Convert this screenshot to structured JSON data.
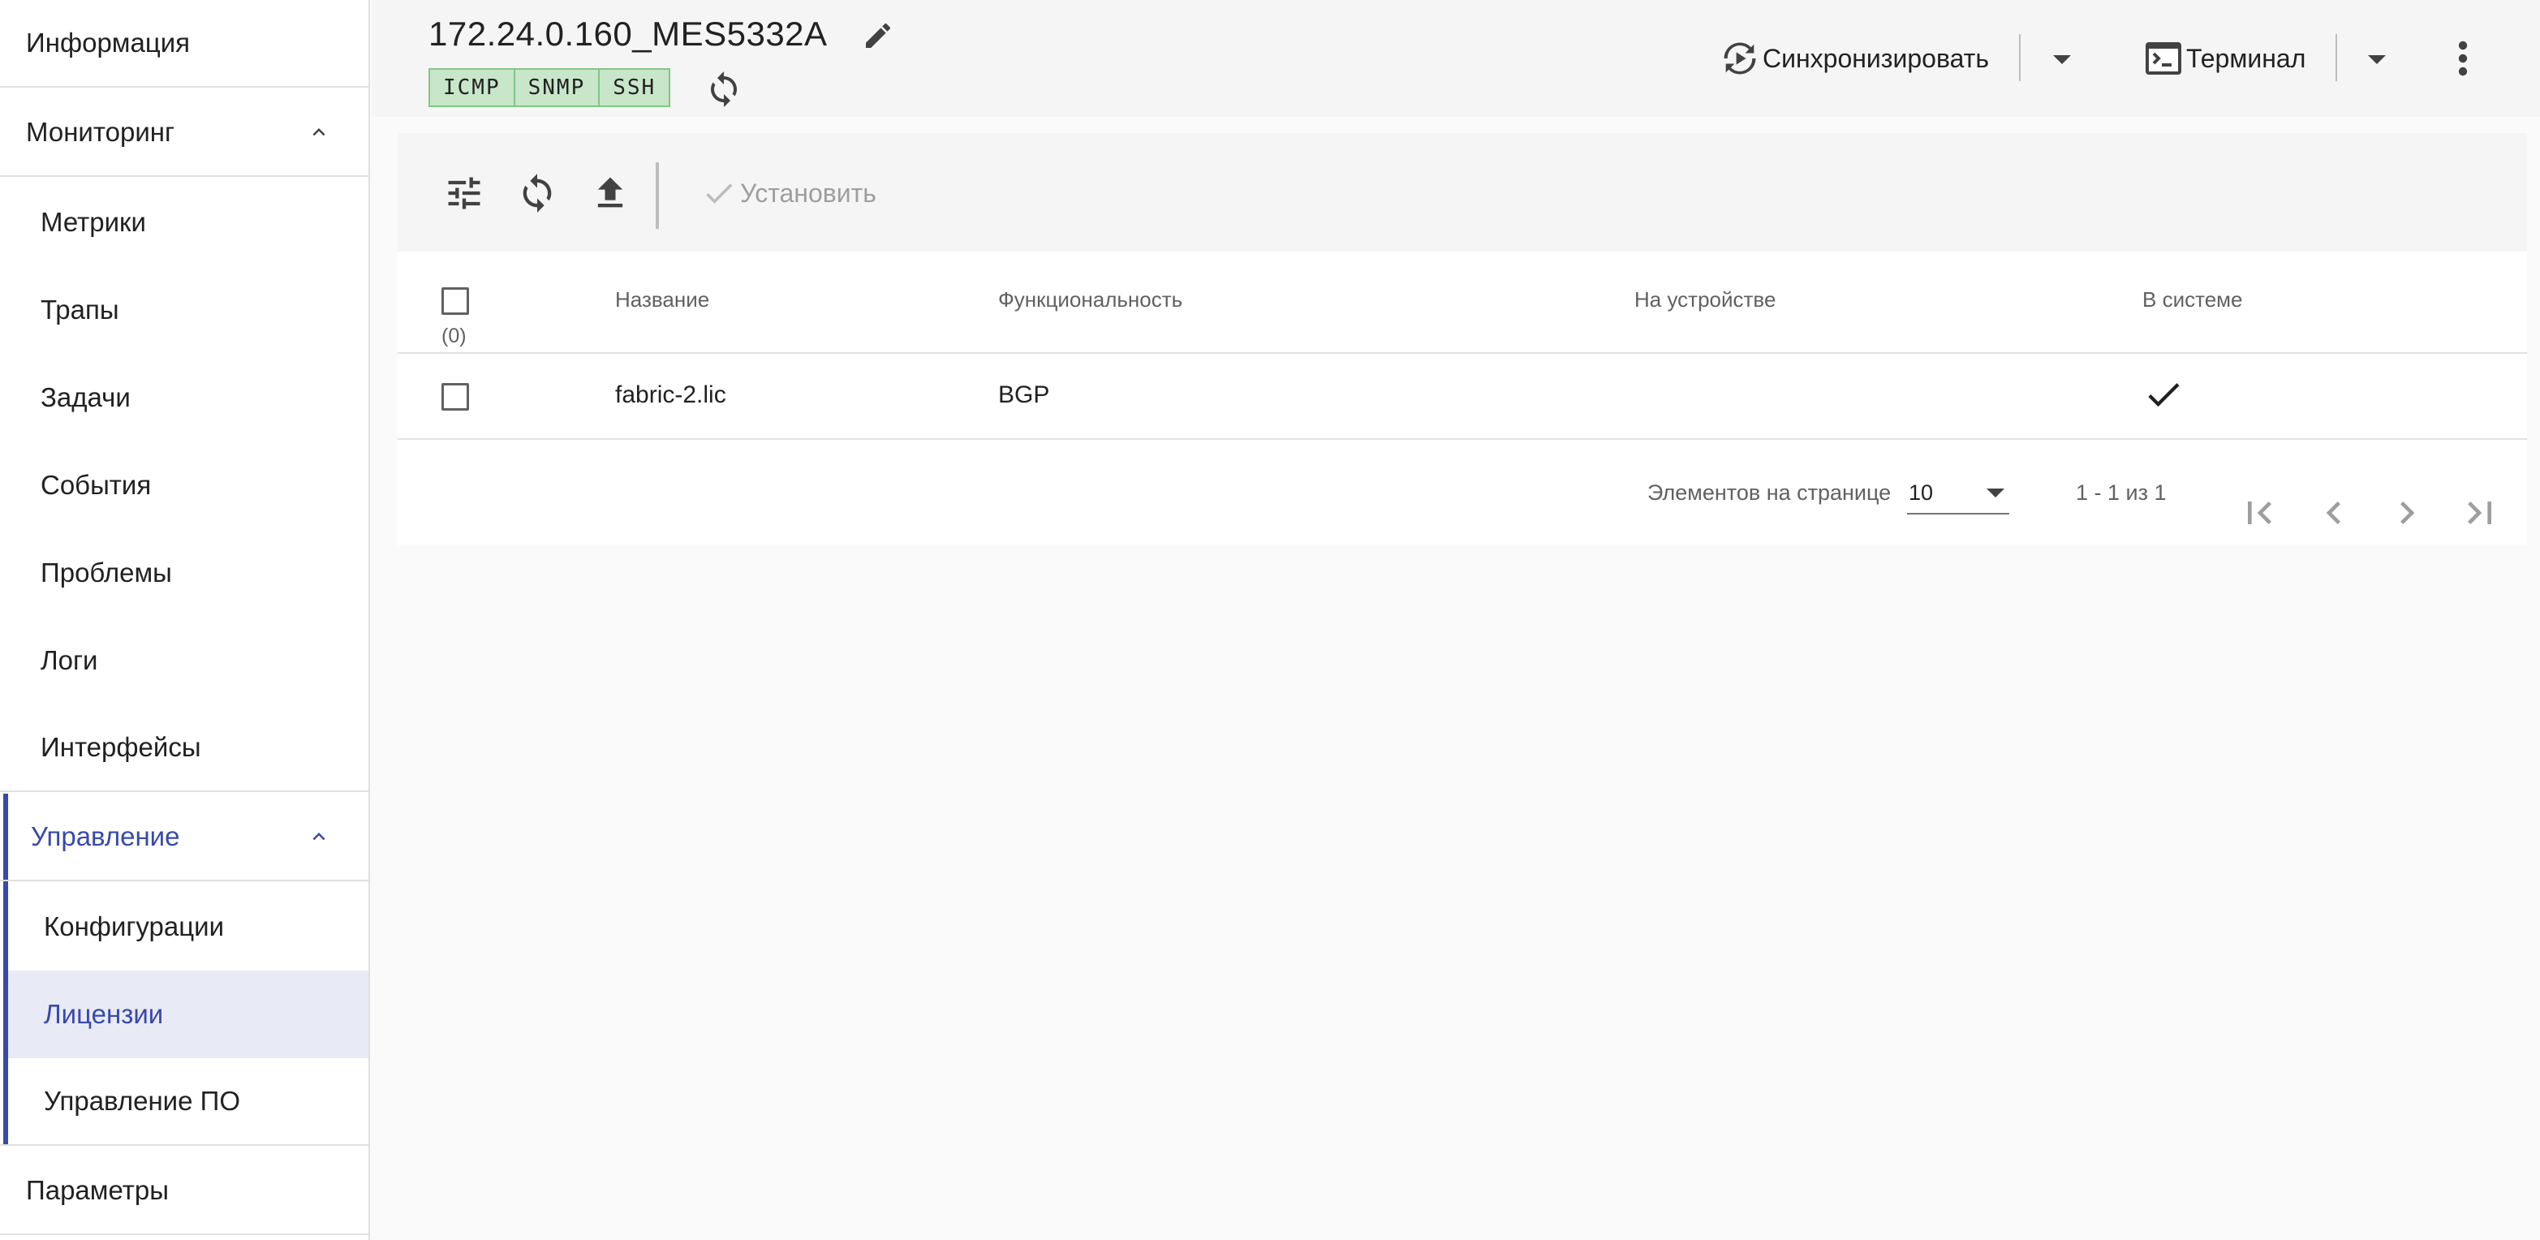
{
  "sidebar": {
    "info": "Информация",
    "monitoring": "Мониторинг",
    "monitoring_items": [
      "Метрики",
      "Трапы",
      "Задачи",
      "События",
      "Проблемы",
      "Логи",
      "Интерфейсы"
    ],
    "management": "Управление",
    "management_items": [
      "Конфигурации",
      "Лицензии",
      "Управление ПО"
    ],
    "active_item": "Лицензии",
    "params": "Параметры"
  },
  "header": {
    "title": "172.24.0.160_MES5332A",
    "badges": [
      "ICMP",
      "SNMP",
      "SSH"
    ],
    "sync_label": "Синхронизировать",
    "terminal_label": "Терминал"
  },
  "toolbar": {
    "install_label": "Установить"
  },
  "table": {
    "selected_count": "(0)",
    "columns": [
      "Название",
      "Функциональность",
      "На устройстве",
      "В системе"
    ],
    "rows": [
      {
        "name": "fabric-2.lic",
        "feature": "BGP",
        "on_device": "",
        "in_system": true
      }
    ]
  },
  "pagination": {
    "per_page_label": "Элементов на странице",
    "per_page_value": "10",
    "range": "1 - 1 из 1"
  },
  "colors": {
    "accent": "#3949ab",
    "badge_bg": "#c8e6c9",
    "selected_bg": "#e8eaf6"
  }
}
